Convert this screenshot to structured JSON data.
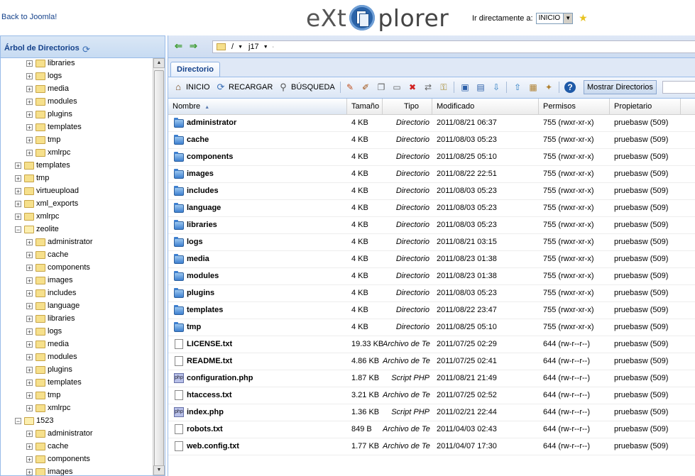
{
  "header": {
    "back_link": "Back to Joomla!",
    "logo_left": "eXt",
    "logo_right": "plorer",
    "goto_label": "Ir directamente a:",
    "goto_value": "INICIO"
  },
  "tree": {
    "title": "Árbol de Directorios",
    "items": [
      {
        "label": "libraries",
        "level": 2,
        "open": false
      },
      {
        "label": "logs",
        "level": 2,
        "open": false
      },
      {
        "label": "media",
        "level": 2,
        "open": false
      },
      {
        "label": "modules",
        "level": 2,
        "open": false
      },
      {
        "label": "plugins",
        "level": 2,
        "open": false
      },
      {
        "label": "templates",
        "level": 2,
        "open": false
      },
      {
        "label": "tmp",
        "level": 2,
        "open": false
      },
      {
        "label": "xmlrpc",
        "level": 2,
        "open": false
      },
      {
        "label": "templates",
        "level": 1,
        "open": false
      },
      {
        "label": "tmp",
        "level": 1,
        "open": false
      },
      {
        "label": "virtueupload",
        "level": 1,
        "open": false
      },
      {
        "label": "xml_exports",
        "level": 1,
        "open": false
      },
      {
        "label": "xmlrpc",
        "level": 1,
        "open": false
      },
      {
        "label": "zeolite",
        "level": 1,
        "open": true
      },
      {
        "label": "administrator",
        "level": 2,
        "open": false
      },
      {
        "label": "cache",
        "level": 2,
        "open": false
      },
      {
        "label": "components",
        "level": 2,
        "open": false
      },
      {
        "label": "images",
        "level": 2,
        "open": false
      },
      {
        "label": "includes",
        "level": 2,
        "open": false
      },
      {
        "label": "language",
        "level": 2,
        "open": false
      },
      {
        "label": "libraries",
        "level": 2,
        "open": false
      },
      {
        "label": "logs",
        "level": 2,
        "open": false
      },
      {
        "label": "media",
        "level": 2,
        "open": false
      },
      {
        "label": "modules",
        "level": 2,
        "open": false
      },
      {
        "label": "plugins",
        "level": 2,
        "open": false
      },
      {
        "label": "templates",
        "level": 2,
        "open": false
      },
      {
        "label": "tmp",
        "level": 2,
        "open": false
      },
      {
        "label": "xmlrpc",
        "level": 2,
        "open": false
      },
      {
        "label": "1523",
        "level": 1,
        "open": true
      },
      {
        "label": "administrator",
        "level": 2,
        "open": false
      },
      {
        "label": "cache",
        "level": 2,
        "open": false
      },
      {
        "label": "components",
        "level": 2,
        "open": false
      },
      {
        "label": "images",
        "level": 2,
        "open": false
      }
    ]
  },
  "path": {
    "segments": [
      "/",
      "j17"
    ]
  },
  "tabs": [
    {
      "label": "Directorio"
    }
  ],
  "toolbar": {
    "home_label": "INICIO",
    "reload_label": "RECARGAR",
    "search_label": "BÚSQUEDA",
    "show_dirs_label": "Mostrar Directorios"
  },
  "grid": {
    "columns": [
      "Nombre",
      "Tamaño",
      "Tipo",
      "Modificado",
      "Permisos",
      "Propietario"
    ],
    "sort_arrow": "▲",
    "rows": [
      {
        "name": "administrator",
        "size": "4 KB",
        "type": "Directorio",
        "modified": "2011/08/21 06:37",
        "perms": "755 (rwxr-xr-x)",
        "owner": "pruebasw (509)",
        "icon": "folder"
      },
      {
        "name": "cache",
        "size": "4 KB",
        "type": "Directorio",
        "modified": "2011/08/03 05:23",
        "perms": "755 (rwxr-xr-x)",
        "owner": "pruebasw (509)",
        "icon": "folder"
      },
      {
        "name": "components",
        "size": "4 KB",
        "type": "Directorio",
        "modified": "2011/08/25 05:10",
        "perms": "755 (rwxr-xr-x)",
        "owner": "pruebasw (509)",
        "icon": "folder"
      },
      {
        "name": "images",
        "size": "4 KB",
        "type": "Directorio",
        "modified": "2011/08/22 22:51",
        "perms": "755 (rwxr-xr-x)",
        "owner": "pruebasw (509)",
        "icon": "folder"
      },
      {
        "name": "includes",
        "size": "4 KB",
        "type": "Directorio",
        "modified": "2011/08/03 05:23",
        "perms": "755 (rwxr-xr-x)",
        "owner": "pruebasw (509)",
        "icon": "folder"
      },
      {
        "name": "language",
        "size": "4 KB",
        "type": "Directorio",
        "modified": "2011/08/03 05:23",
        "perms": "755 (rwxr-xr-x)",
        "owner": "pruebasw (509)",
        "icon": "folder"
      },
      {
        "name": "libraries",
        "size": "4 KB",
        "type": "Directorio",
        "modified": "2011/08/03 05:23",
        "perms": "755 (rwxr-xr-x)",
        "owner": "pruebasw (509)",
        "icon": "folder"
      },
      {
        "name": "logs",
        "size": "4 KB",
        "type": "Directorio",
        "modified": "2011/08/21 03:15",
        "perms": "755 (rwxr-xr-x)",
        "owner": "pruebasw (509)",
        "icon": "folder"
      },
      {
        "name": "media",
        "size": "4 KB",
        "type": "Directorio",
        "modified": "2011/08/23 01:38",
        "perms": "755 (rwxr-xr-x)",
        "owner": "pruebasw (509)",
        "icon": "folder"
      },
      {
        "name": "modules",
        "size": "4 KB",
        "type": "Directorio",
        "modified": "2011/08/23 01:38",
        "perms": "755 (rwxr-xr-x)",
        "owner": "pruebasw (509)",
        "icon": "folder"
      },
      {
        "name": "plugins",
        "size": "4 KB",
        "type": "Directorio",
        "modified": "2011/08/03 05:23",
        "perms": "755 (rwxr-xr-x)",
        "owner": "pruebasw (509)",
        "icon": "folder"
      },
      {
        "name": "templates",
        "size": "4 KB",
        "type": "Directorio",
        "modified": "2011/08/22 23:47",
        "perms": "755 (rwxr-xr-x)",
        "owner": "pruebasw (509)",
        "icon": "folder"
      },
      {
        "name": "tmp",
        "size": "4 KB",
        "type": "Directorio",
        "modified": "2011/08/25 05:10",
        "perms": "755 (rwxr-xr-x)",
        "owner": "pruebasw (509)",
        "icon": "folder"
      },
      {
        "name": "LICENSE.txt",
        "size": "19.33 KB",
        "type": "Archivo de Te",
        "modified": "2011/07/25 02:29",
        "perms": "644 (rw-r--r--)",
        "owner": "pruebasw (509)",
        "icon": "txt"
      },
      {
        "name": "README.txt",
        "size": "4.86 KB",
        "type": "Archivo de Te",
        "modified": "2011/07/25 02:41",
        "perms": "644 (rw-r--r--)",
        "owner": "pruebasw (509)",
        "icon": "txt"
      },
      {
        "name": "configuration.php",
        "size": "1.87 KB",
        "type": "Script PHP",
        "modified": "2011/08/21 21:49",
        "perms": "644 (rw-r--r--)",
        "owner": "pruebasw (509)",
        "icon": "php"
      },
      {
        "name": "htaccess.txt",
        "size": "3.21 KB",
        "type": "Archivo de Te",
        "modified": "2011/07/25 02:52",
        "perms": "644 (rw-r--r--)",
        "owner": "pruebasw (509)",
        "icon": "txt"
      },
      {
        "name": "index.php",
        "size": "1.36 KB",
        "type": "Script PHP",
        "modified": "2011/02/21 22:44",
        "perms": "644 (rw-r--r--)",
        "owner": "pruebasw (509)",
        "icon": "php"
      },
      {
        "name": "robots.txt",
        "size": "849 B",
        "type": "Archivo de Te",
        "modified": "2011/04/03 02:43",
        "perms": "644 (rw-r--r--)",
        "owner": "pruebasw (509)",
        "icon": "txt"
      },
      {
        "name": "web.config.txt",
        "size": "1.77 KB",
        "type": "Archivo de Te",
        "modified": "2011/04/07 17:30",
        "perms": "644 (rw-r--r--)",
        "owner": "pruebasw (509)",
        "icon": "txt"
      }
    ]
  }
}
